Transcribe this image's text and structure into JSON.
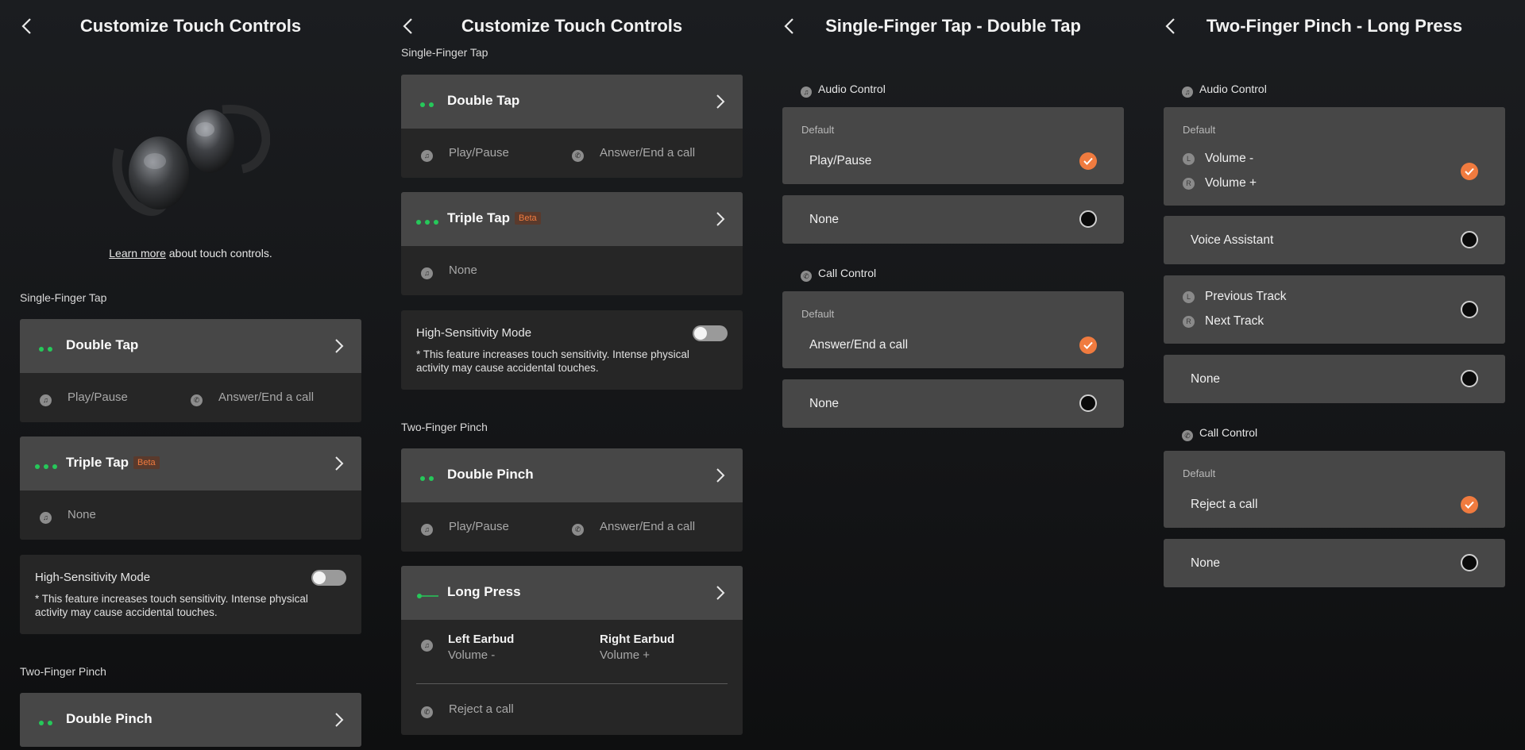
{
  "screen1": {
    "title": "Customize Touch Controls",
    "learn_more_link": "Learn more",
    "learn_more_rest": " about touch controls.",
    "section_single": "Single-Finger Tap",
    "double_tap": {
      "name": "Double Tap",
      "audio": "Play/Pause",
      "call": "Answer/End a call"
    },
    "triple_tap": {
      "name": "Triple Tap",
      "badge": "Beta",
      "audio": "None"
    },
    "high_sens": {
      "label": "High-Sensitivity Mode",
      "desc": "* This feature increases touch sensitivity. Intense physical activity may cause accidental touches.",
      "enabled": false
    },
    "section_pinch": "Two-Finger Pinch",
    "double_pinch": {
      "name": "Double Pinch"
    }
  },
  "screen2": {
    "title": "Customize Touch Controls",
    "section_single": "Single-Finger Tap",
    "double_tap": {
      "name": "Double Tap",
      "audio": "Play/Pause",
      "call": "Answer/End a call"
    },
    "triple_tap": {
      "name": "Triple Tap",
      "badge": "Beta",
      "audio": "None"
    },
    "high_sens": {
      "label": "High-Sensitivity Mode",
      "desc": "* This feature increases touch sensitivity. Intense physical activity may cause accidental touches.",
      "enabled": false
    },
    "section_pinch": "Two-Finger Pinch",
    "double_pinch": {
      "name": "Double Pinch",
      "audio": "Play/Pause",
      "call": "Answer/End a call"
    },
    "long_press": {
      "name": "Long Press",
      "left_title": "Left Earbud",
      "left_value": "Volume -",
      "right_title": "Right Earbud",
      "right_value": "Volume +",
      "call": "Reject a call"
    }
  },
  "screen3": {
    "title": "Single-Finger Tap - Double Tap",
    "audio_group": "Audio Control",
    "audio_default_label": "Default",
    "audio_default": "Play/Pause",
    "audio_none": "None",
    "call_group": "Call Control",
    "call_default_label": "Default",
    "call_default": "Answer/End a call",
    "call_none": "None"
  },
  "screen4": {
    "title": "Two-Finger Pinch - Long Press",
    "audio_group": "Audio Control",
    "audio_default_label": "Default",
    "vol_left_badge": "L",
    "vol_left": "Volume -",
    "vol_right_badge": "R",
    "vol_right": "Volume +",
    "voice_assistant": "Voice Assistant",
    "track_left_badge": "L",
    "track_left": "Previous Track",
    "track_right_badge": "R",
    "track_right": "Next Track",
    "audio_none": "None",
    "call_group": "Call Control",
    "call_default_label": "Default",
    "call_default": "Reject a call",
    "call_none": "None"
  },
  "colors": {
    "accent": "#f07b3f",
    "indicator": "#26c85a",
    "card": "#474747",
    "panel": "#262626"
  },
  "icons": [
    "back-chevron-icon",
    "chevron-right-icon",
    "music-note-icon",
    "phone-icon",
    "check-icon",
    "earbuds-image"
  ]
}
